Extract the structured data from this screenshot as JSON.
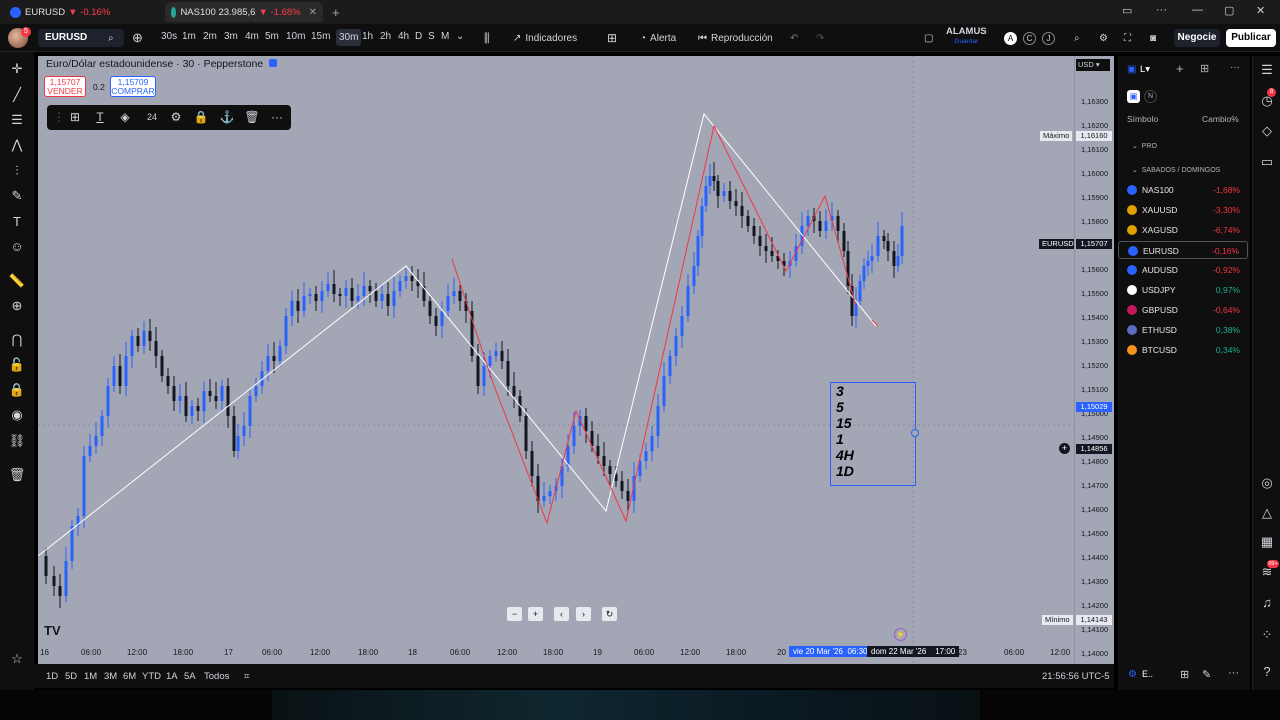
{
  "browser_tabs": [
    {
      "symbol": "EURUSD",
      "price": "1,15707",
      "change": "▼ -0.16%",
      "suffix": "/ E"
    },
    {
      "symbol": "NAS100",
      "price": "23.985,6",
      "change": "▼ -1.68%",
      "suffix": "/ ..."
    }
  ],
  "toolbar": {
    "symbol": "EURUSD",
    "timeframes": [
      "30s",
      "1m",
      "2m",
      "3m",
      "4m",
      "5m",
      "10m",
      "15m",
      "30m",
      "1h",
      "2h",
      "4h",
      "D",
      "S",
      "M"
    ],
    "active_timeframe": "30m",
    "indicators_label": "Indicadores",
    "alert_label": "Alerta",
    "replay_label": "Reproducción",
    "layout_name": "ALAMUS",
    "layout_sub": "Guardar",
    "trade_label": "Negocie",
    "publish_label": "Publicar"
  },
  "chart": {
    "title": "Euro/Dólar estadounidense · 30 · Pepperstone",
    "sell_price": "1,15707",
    "sell_label": "VENDER",
    "buy_price": "1,15709",
    "buy_label": "COMPRAR",
    "spread": "0.2",
    "float_toolbar_font_size": "24",
    "textbox_lines": [
      "3",
      "5",
      "15",
      "1",
      "4H",
      "1D"
    ],
    "colors": {
      "background": "#a3a6b4",
      "up_candle": "#2962ff",
      "down_candle": "#131722",
      "red_zigzag": "#f23645",
      "white_lines": "#ffffff"
    }
  },
  "price_axis": {
    "ticks": [
      "1,16300",
      "1,16200",
      "1,16100",
      "1,16000",
      "1,15900",
      "1,15800",
      "1,15700",
      "1,15600",
      "1,15500",
      "1,15400",
      "1,15300",
      "1,15200",
      "1,15100",
      "1,15000",
      "1,14900",
      "1,14800",
      "1,14700",
      "1,14600",
      "1,14500",
      "1,14400",
      "1,14300",
      "1,14200",
      "1,14100",
      "1,14000"
    ],
    "currency": "USD",
    "maximo_label": "Máximo",
    "maximo_value": "1,16160",
    "current_symbol": "EURUSD",
    "current_value": "1,15707",
    "crosshair_value": "1,14856",
    "marker_value": "1,15029",
    "minimo_label": "Mínimo",
    "minimo_value": "1,14143"
  },
  "time_axis": {
    "ticks": [
      "16",
      "06:00",
      "12:00",
      "18:00",
      "17",
      "06:00",
      "12:00",
      "18:00",
      "18",
      "06:00",
      "12:00",
      "18:00",
      "19",
      "06:00",
      "12:00",
      "18:00",
      "20",
      "23",
      "06:00",
      "12:00"
    ],
    "range_start": "vie 20 Mar '26",
    "range_start_time": "06:30",
    "range_end": "dom 22 Mar '26",
    "range_end_time": "17:00"
  },
  "bottom_bar": {
    "ranges": [
      "1D",
      "5D",
      "1M",
      "3M",
      "6M",
      "YTD",
      "1A",
      "5A",
      "Todos"
    ],
    "clock": "21:56:56 UTC-5"
  },
  "watchlist": {
    "header_col1": "Símbolo",
    "header_col2": "Cambio%",
    "section_pro": "PRO",
    "section_weekend": "SABADOS / DOMINGOS",
    "rows": [
      {
        "symbol": "NAS100",
        "change": "-1,68%",
        "dir": "neg",
        "icon_color": "#2962ff"
      },
      {
        "symbol": "XAUUSD",
        "change": "-3,30%",
        "dir": "neg",
        "icon_color": "#e0a100"
      },
      {
        "symbol": "XAGUSD",
        "change": "-6,74%",
        "dir": "neg",
        "icon_color": "#e0a100"
      },
      {
        "symbol": "EURUSD",
        "change": "-0,16%",
        "dir": "neg",
        "icon_color": "#2962ff"
      },
      {
        "symbol": "AUDUSD",
        "change": "-0,92%",
        "dir": "neg",
        "icon_color": "#2962ff"
      },
      {
        "symbol": "USDJPY",
        "change": "0,97%",
        "dir": "pos",
        "icon_color": "#ffffff"
      },
      {
        "symbol": "GBPUSD",
        "change": "-0,64%",
        "dir": "neg",
        "icon_color": "#c2185b"
      },
      {
        "symbol": "ETHUSD",
        "change": "0,38%",
        "dir": "pos",
        "icon_color": "#5c6bc0"
      },
      {
        "symbol": "BTCUSD",
        "change": "0,34%",
        "dir": "pos",
        "icon_color": "#f7931a"
      }
    ],
    "selected_symbol": "EURUSD"
  },
  "rail_badges": {
    "alerts": "8",
    "notifications": "99+"
  }
}
